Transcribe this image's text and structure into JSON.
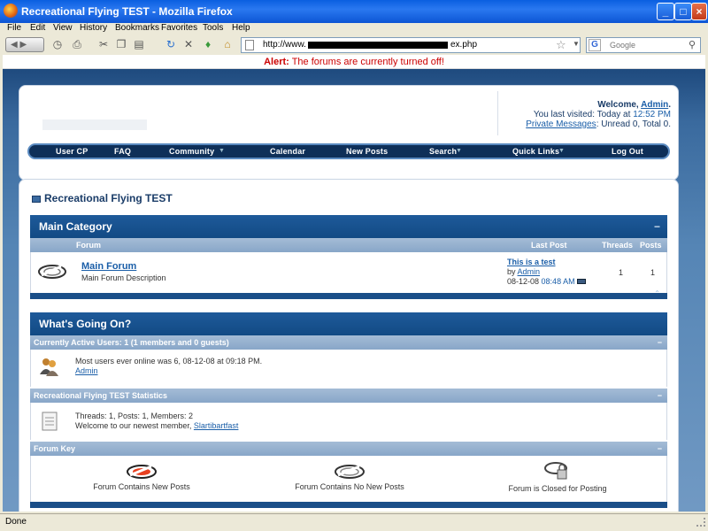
{
  "window": {
    "title": "Recreational Flying TEST - Mozilla Firefox",
    "min_label": "_",
    "max_label": "□",
    "close_label": "×"
  },
  "menu": [
    "File",
    "Edit",
    "View",
    "History",
    "Bookmarks",
    "Favorites",
    "Tools",
    "Help"
  ],
  "address": {
    "url_prefix": "http://www.",
    "url_suffix": "ex.php",
    "search_placeholder": "Google",
    "search_engine_glyph": "G"
  },
  "alert": {
    "label": "Alert:",
    "message": "The forums are currently turned off!"
  },
  "header": {
    "welcome_prefix": "Welcome,",
    "username": "Admin",
    "welcome_suffix": ".",
    "last_visited": "You last visited: Today at",
    "last_visited_time": "12:52 PM",
    "pm_link": "Private Messages",
    "pm_counts": ": Unread 0, Total 0."
  },
  "navbar": [
    "User CP",
    "FAQ",
    "Community",
    "Calendar",
    "New Posts",
    "Search",
    "Quick Links",
    "Log Out"
  ],
  "page_title": "Recreational Flying TEST",
  "category": {
    "title": "Main Category",
    "collapse": "−",
    "columns": {
      "forum": "Forum",
      "last_post": "Last Post",
      "threads": "Threads",
      "posts": "Posts"
    },
    "forums": [
      {
        "title": "Main Forum",
        "description": "Main Forum Description",
        "last_post_title": "This is a test",
        "last_post_by": "by",
        "last_post_user": "Admin",
        "last_post_date": "08-12-08",
        "last_post_time": "08:48 AM",
        "threads": "1",
        "posts": "1"
      }
    ]
  },
  "whats_going_on": {
    "title": "What's Going On?",
    "active_users_header": "Currently Active Users: 1 (1 members and 0 guests)",
    "most_online": "Most users ever online was 6, 08-12-08 at 09:18 PM.",
    "online_user": "Admin",
    "stats_header": "Recreational Flying TEST Statistics",
    "stats_line": "Threads: 1, Posts: 1, Members: 2",
    "newest_member_prefix": "Welcome to our newest member,",
    "newest_member": "Slartibartfast",
    "key_header": "Forum Key",
    "key_items": [
      "Forum Contains New Posts",
      "Forum Contains No New Posts",
      "Forum is Closed for Posting"
    ]
  },
  "status": {
    "text": "Done"
  },
  "colors": {
    "accent_blue": "#1a4e88",
    "link_blue": "#1a5ea8",
    "alert_red": "#cc0000"
  }
}
